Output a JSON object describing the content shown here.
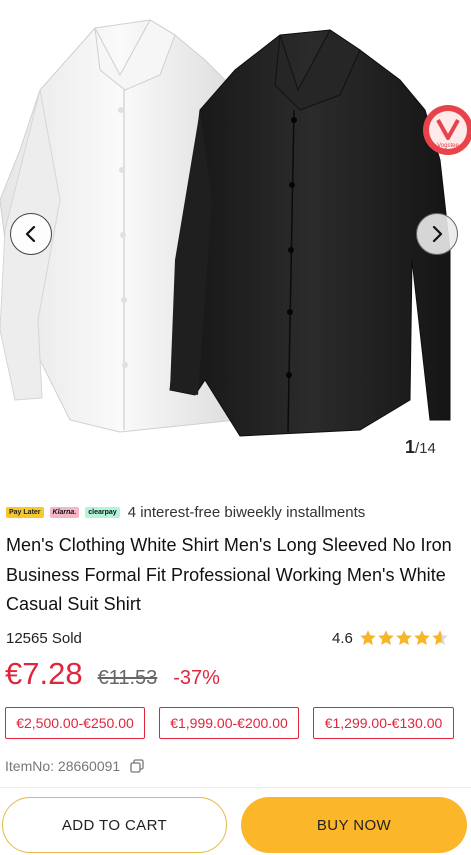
{
  "gallery": {
    "current": "1",
    "total": "/14",
    "badge_text": "Vogstee",
    "icons": [
      "chevron-left-icon",
      "chevron-right-icon"
    ]
  },
  "installments": {
    "logos": [
      "Pay Later",
      "Klarna.",
      "clearpay"
    ],
    "text": "4 interest-free biweekly installments"
  },
  "product": {
    "title": "Men's Clothing White Shirt Men's Long Sleeved No Iron Business Formal Fit Professional Working Men's White Casual Suit Shirt",
    "sold": "12565 Sold",
    "rating": "4.6",
    "rating_value": 4.6,
    "rating_max": 5,
    "price": "€7.28",
    "original_price": "€11.53",
    "discount": "-37%",
    "item_no": "ItemNo: 28660091"
  },
  "coupons": [
    "€2,500.00-€250.00",
    "€1,999.00-€200.00",
    "€1,299.00-€130.00"
  ],
  "actions": {
    "add_to_cart": "ADD TO CART",
    "buy_now": "BUY NOW"
  },
  "colors": {
    "price_red": "#e0263b",
    "star": "#f6b62b",
    "buy_now_bg": "#fbb62a",
    "add_cart_border": "#e5b94a"
  }
}
